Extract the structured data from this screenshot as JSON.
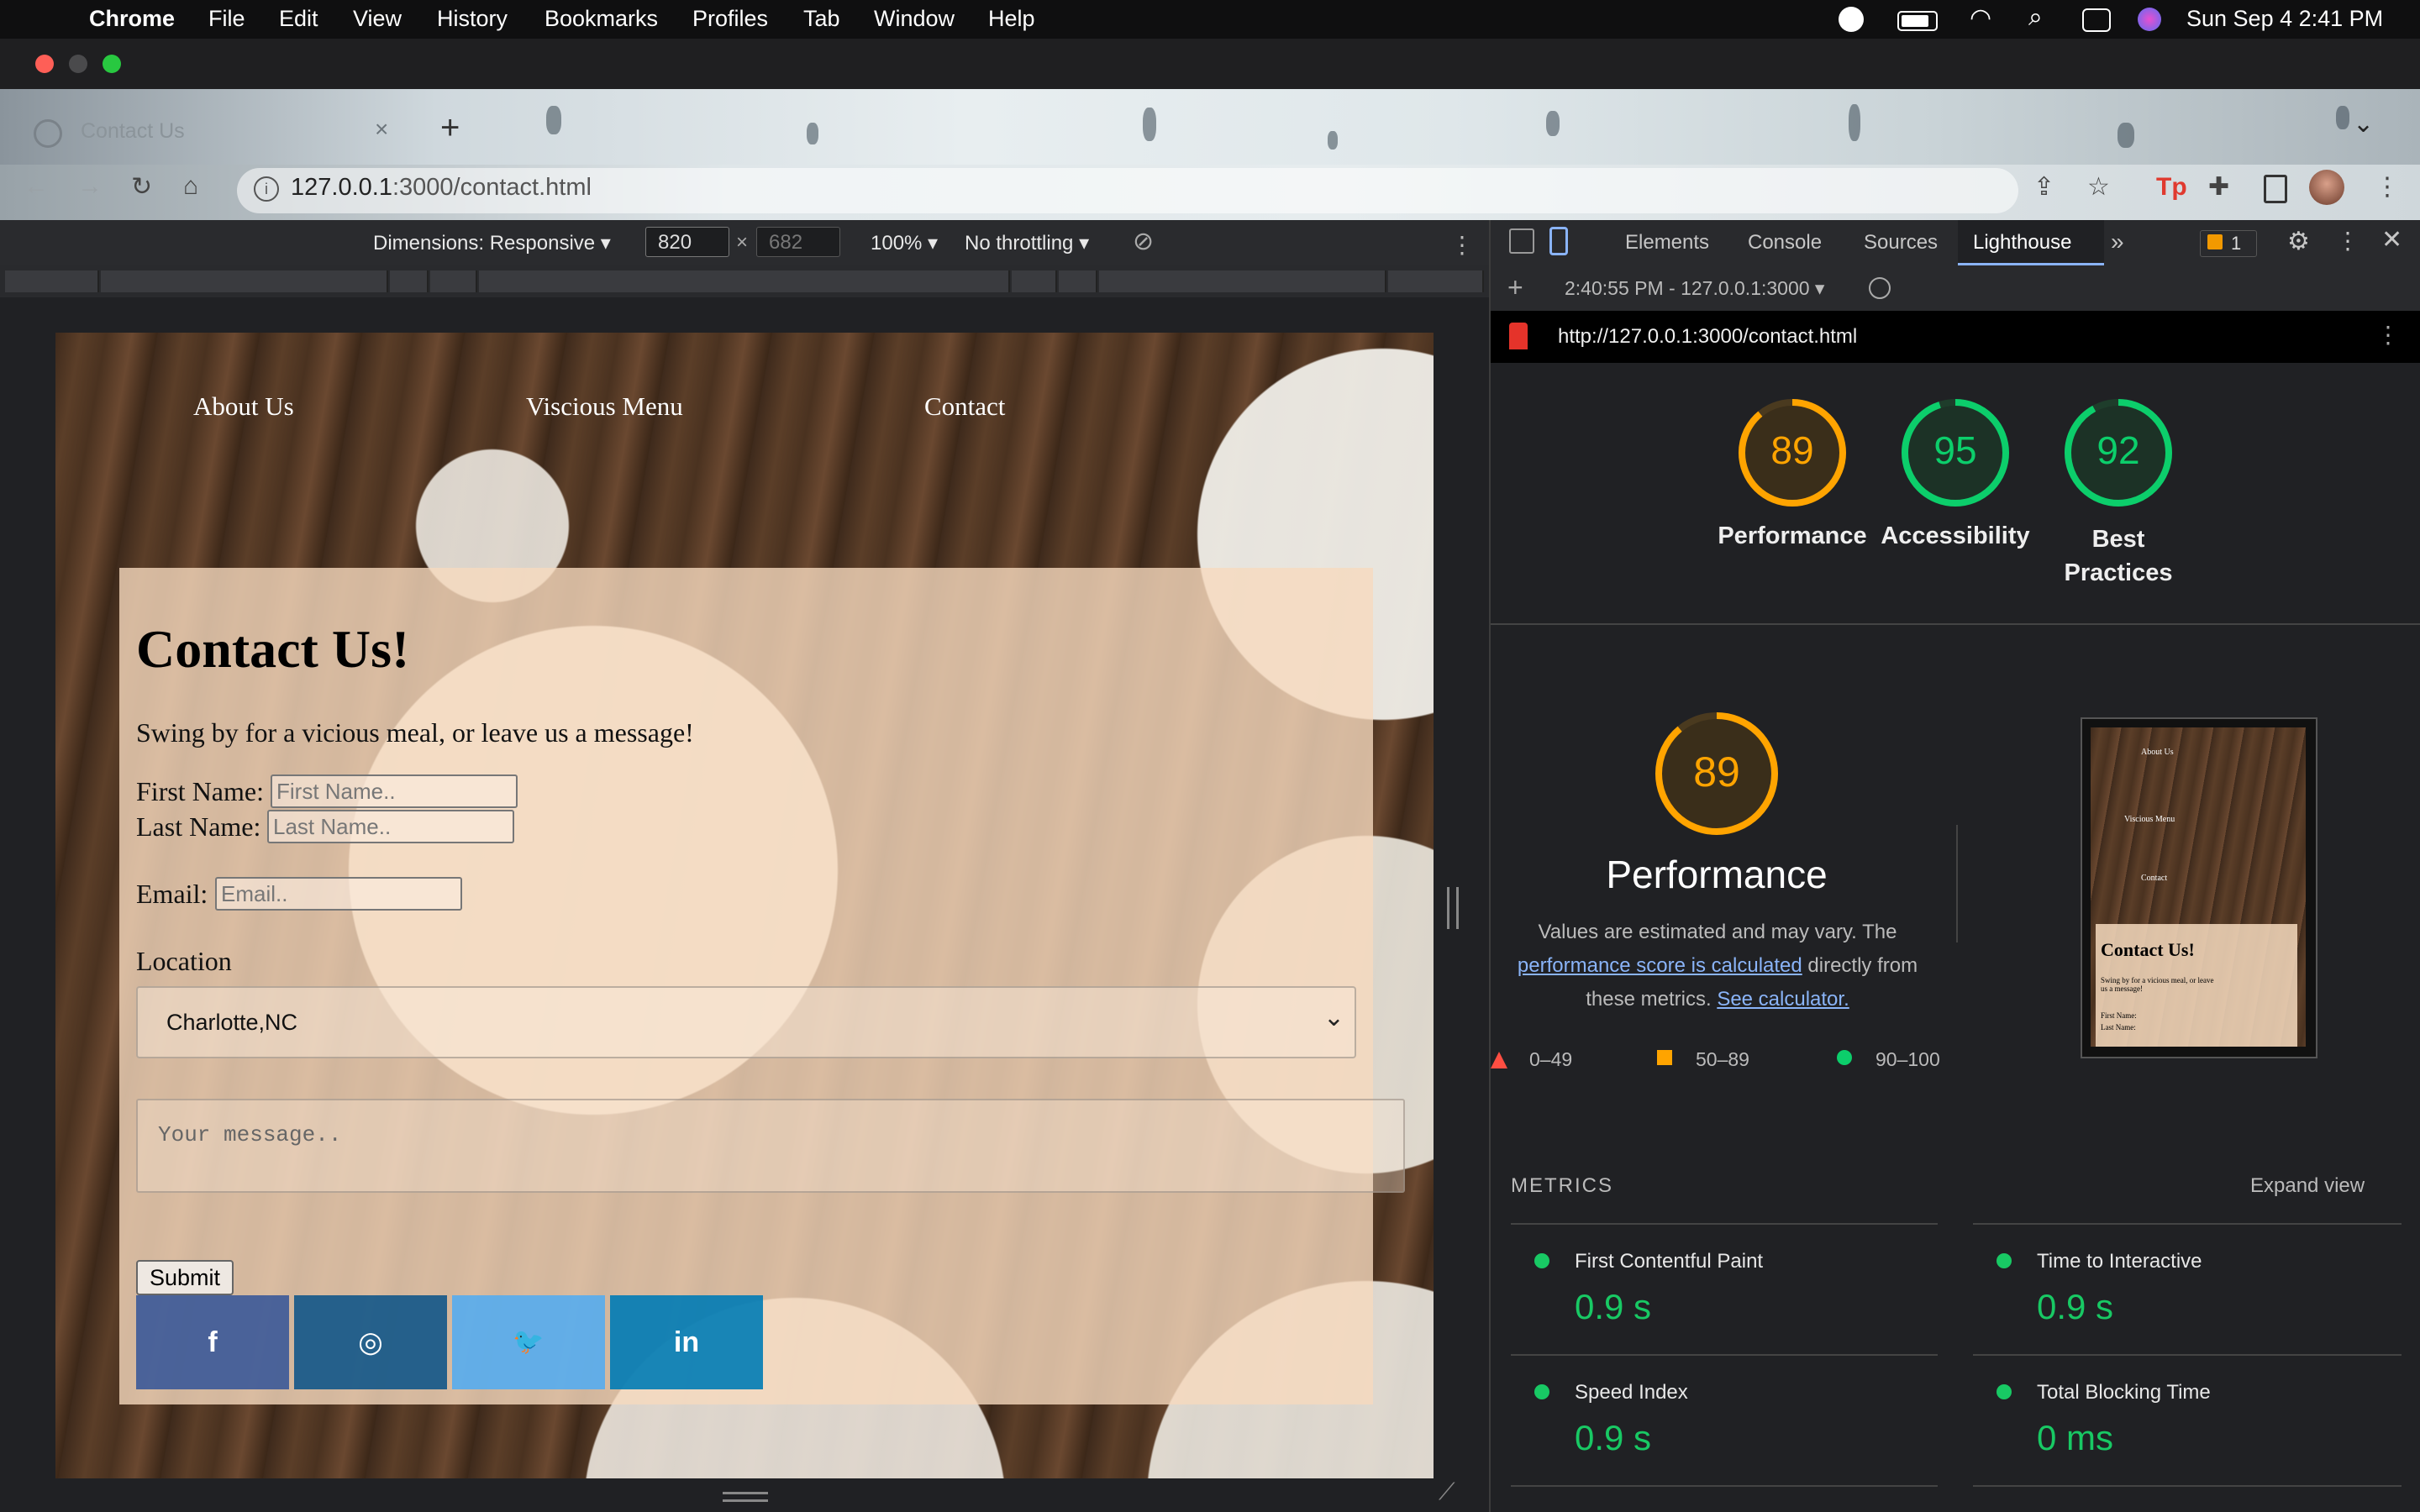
{
  "menubar": {
    "app": "Chrome",
    "items": [
      "File",
      "Edit",
      "View",
      "History",
      "Bookmarks",
      "Profiles",
      "Tab",
      "Window",
      "Help"
    ],
    "datetime": "Sun Sep 4  2:41 PM"
  },
  "browser": {
    "tab_title": "Contact Us",
    "url_host": "127.0.0.1",
    "url_rest": ":3000/contact.html"
  },
  "device_toolbar": {
    "dimensions_label": "Dimensions: Responsive",
    "width": "820",
    "height_placeholder": "682",
    "zoom": "100%",
    "throttling": "No throttling"
  },
  "site": {
    "nav": [
      "About Us",
      "Viscious Menu",
      "Contact"
    ],
    "title": "Contact Us!",
    "subtitle": "Swing by for a vicious meal, or leave us a message!",
    "first_name_label": "First Name:",
    "first_name_placeholder": "First Name..",
    "last_name_label": "Last Name:",
    "last_name_placeholder": "Last Name..",
    "email_label": "Email:",
    "email_placeholder": "Email..",
    "location_label": "Location",
    "location_value": "Charlotte,NC",
    "message_placeholder": "Your message..",
    "submit_label": "Submit",
    "social": [
      {
        "name": "facebook",
        "glyph": "f",
        "color": "#3b5998"
      },
      {
        "name": "instagram",
        "glyph": "◎",
        "color": "#125688"
      },
      {
        "name": "twitter",
        "glyph": "🐦",
        "color": "#55acee"
      },
      {
        "name": "linkedin",
        "glyph": "in",
        "color": "#007bb5"
      }
    ]
  },
  "devtools": {
    "tabs": [
      "Elements",
      "Console",
      "Sources",
      "Lighthouse"
    ],
    "active_tab": "Lighthouse",
    "issues_count": "1",
    "report_time": "2:40:55 PM - 127.0.0.1:3000",
    "report_url": "http://127.0.0.1:3000/contact.html",
    "scores": [
      {
        "label": "Performance",
        "value": 89,
        "color": "#ffa400"
      },
      {
        "label": "Accessibility",
        "value": 95,
        "color": "#0cce6b"
      },
      {
        "label": "Best Practices",
        "value": 92,
        "color": "#0cce6b"
      }
    ],
    "perf_title": "Performance",
    "perf_desc_1": "Values are estimated and may vary. The",
    "perf_link": "performance score is calculated",
    "perf_desc_2": "directly from",
    "perf_desc_3": "these metrics.",
    "perf_calc_link": "See calculator.",
    "legend": [
      "0–49",
      "50–89",
      "90–100"
    ],
    "metrics_heading": "METRICS",
    "expand_view": "Expand view",
    "metrics": [
      {
        "name": "First Contentful Paint",
        "value": "0.9 s"
      },
      {
        "name": "Time to Interactive",
        "value": "0.9 s"
      },
      {
        "name": "Speed Index",
        "value": "0.9 s"
      },
      {
        "name": "Total Blocking Time",
        "value": "0 ms"
      }
    ],
    "thumb": {
      "nav": [
        "About Us",
        "Viscious Menu",
        "Contact"
      ],
      "title": "Contact Us!",
      "subtitle": "Swing by for a vicious meal, or leave us a message!",
      "first": "First Name:",
      "last": "Last Name:"
    }
  }
}
